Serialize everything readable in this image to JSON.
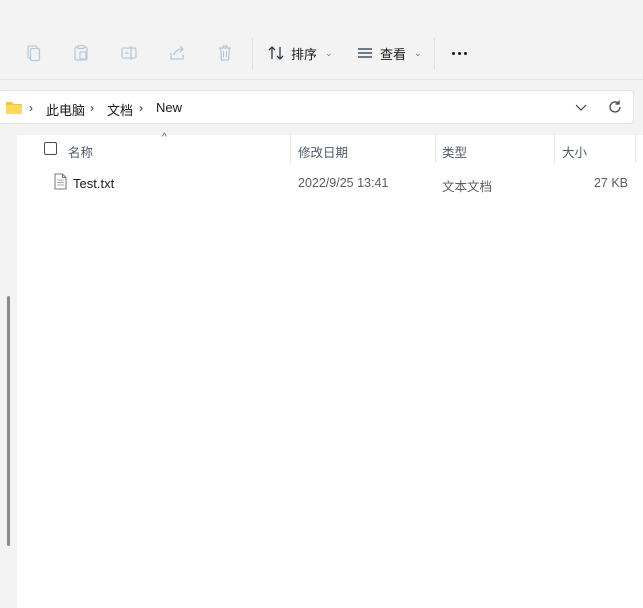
{
  "toolbar": {
    "icons": [
      "cut-icon",
      "copy-icon",
      "paste-icon",
      "rename-icon",
      "share-icon",
      "delete-icon"
    ],
    "sort_label": "排序",
    "view_label": "查看"
  },
  "address": {
    "crumbs": [
      "此电脑",
      "文档",
      "New"
    ]
  },
  "columns": {
    "name": "名称",
    "date": "修改日期",
    "type": "类型",
    "size": "大小"
  },
  "files": [
    {
      "name": "Test.txt",
      "date": "2022/9/25 13:41",
      "type": "文本文档",
      "size": "27 KB"
    }
  ],
  "colors": {
    "toolbar_bg": "#f3f3f3",
    "folder_yellow": "#f5c343",
    "scrollbar": "#8a8a8a"
  }
}
